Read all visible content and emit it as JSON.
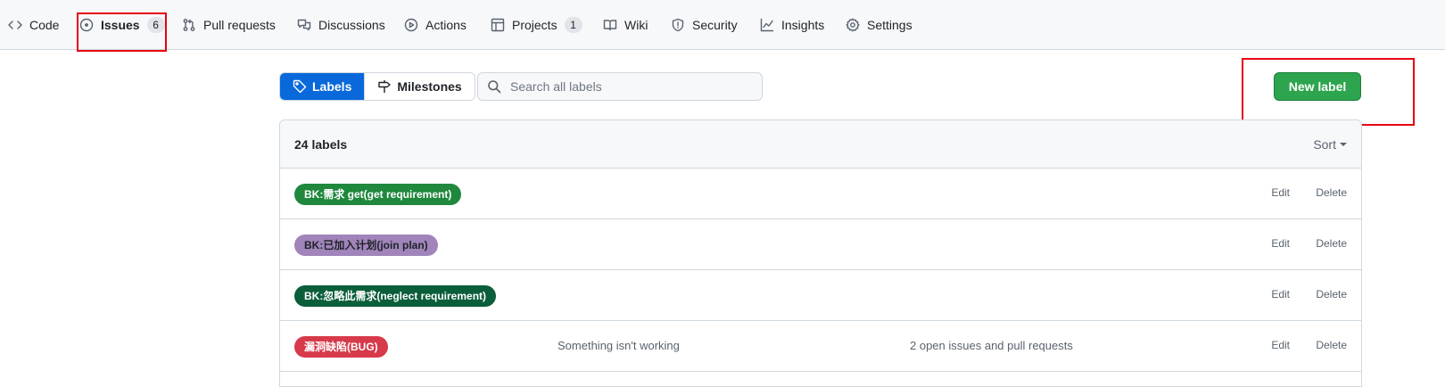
{
  "repo_nav": {
    "items": [
      {
        "label": "Code",
        "icon": "code-icon"
      },
      {
        "label": "Issues",
        "icon": "issue-opened-icon",
        "count": "6",
        "selected": true
      },
      {
        "label": "Pull requests",
        "icon": "git-pull-request-icon"
      },
      {
        "label": "Discussions",
        "icon": "comment-discussion-icon"
      },
      {
        "label": "Actions",
        "icon": "play-icon"
      },
      {
        "label": "Projects",
        "icon": "table-icon",
        "count": "1"
      },
      {
        "label": "Wiki",
        "icon": "book-icon"
      },
      {
        "label": "Security",
        "icon": "shield-icon"
      },
      {
        "label": "Insights",
        "icon": "graph-icon"
      },
      {
        "label": "Settings",
        "icon": "gear-icon"
      }
    ]
  },
  "subnav": {
    "labels_tab": "Labels",
    "milestones_tab": "Milestones",
    "search_placeholder": "Search all labels"
  },
  "new_label_button": "New label",
  "labels_list": {
    "count_text": "24 labels",
    "sort_label": "Sort",
    "edit_label": "Edit",
    "delete_label": "Delete",
    "rows": [
      {
        "name": "BK:需求 get(get requirement)",
        "bg": "#1f883d",
        "fg": "#ffffff",
        "description": "",
        "issues": ""
      },
      {
        "name": "BK:已加入计划(join plan)",
        "bg": "#a084ba",
        "fg": "#1f2328",
        "description": "",
        "issues": ""
      },
      {
        "name": "BK:忽略此需求(neglect requirement)",
        "bg": "#0b5e3a",
        "fg": "#ffffff",
        "description": "",
        "issues": ""
      },
      {
        "name": "漏洞缺陷(BUG)",
        "bg": "#d73a4a",
        "fg": "#ffffff",
        "description": "Something isn't working",
        "issues": "2 open issues and pull requests"
      }
    ]
  },
  "highlight_color": "#e60012"
}
